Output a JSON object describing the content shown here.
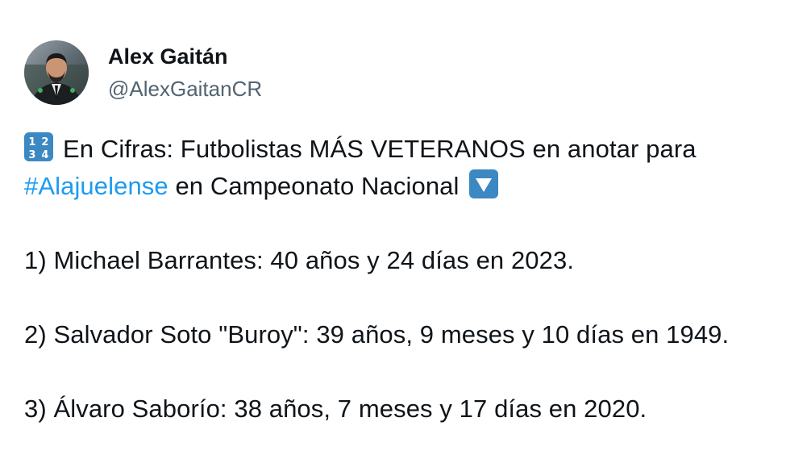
{
  "author": {
    "display_name": "Alex Gaitán",
    "handle": "@AlexGaitanCR"
  },
  "tweet": {
    "intro_part1": "En Cifras: Futbolistas MÁS VETERANOS en anotar para",
    "hashtag": "#Alajuelense",
    "intro_part2": " en Campeonato Nacional",
    "items": [
      "1) Michael Barrantes: 40 años y 24 días en 2023.",
      "2) Salvador Soto \"Buroy\": 39 años, 9 meses y 10 días en 1949.",
      "3) Álvaro Saborío: 38 años, 7 meses y 17 días en 2020."
    ]
  },
  "icons": {
    "numbers_emoji": "input-numbers-icon",
    "down_emoji": "down-triangle-button-icon"
  },
  "colors": {
    "text": "#0f1419",
    "secondary": "#536471",
    "link": "#1d9bf0",
    "emoji_blue": "#3b88c3"
  }
}
